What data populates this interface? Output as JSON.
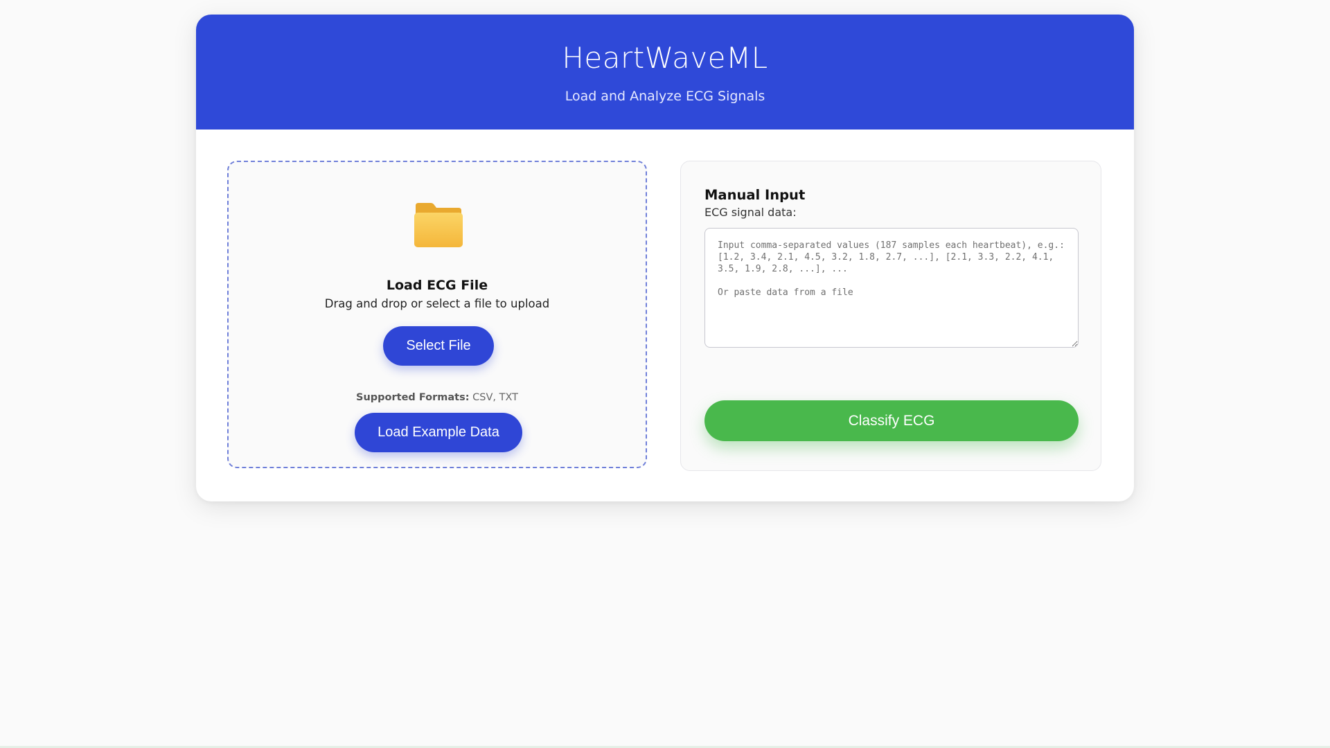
{
  "header": {
    "title": "HeartWaveML",
    "subtitle": "Load and Analyze ECG Signals"
  },
  "upload": {
    "icon": "folder-icon",
    "title": "Load ECG File",
    "hint": "Drag and drop or select a file to upload",
    "select_button": "Select File",
    "formats_label": "Supported Formats:",
    "formats_value": " CSV, TXT",
    "example_button": "Load Example Data"
  },
  "manual": {
    "title": "Manual Input",
    "label": "ECG signal data:",
    "placeholder": "Input comma-separated values (187 samples each heartbeat), e.g.:\n[1.2, 3.4, 2.1, 4.5, 3.2, 1.8, 2.7, ...], [2.1, 3.3, 2.2, 4.1, 3.5, 1.9, 2.8, ...], ...\n\nOr paste data from a file",
    "value": "",
    "classify_button": "Classify ECG"
  },
  "colors": {
    "header_bg": "#2f49d8",
    "primary_button": "#2f46d6",
    "classify_button": "#49b84c",
    "folder": "#f7c443"
  }
}
